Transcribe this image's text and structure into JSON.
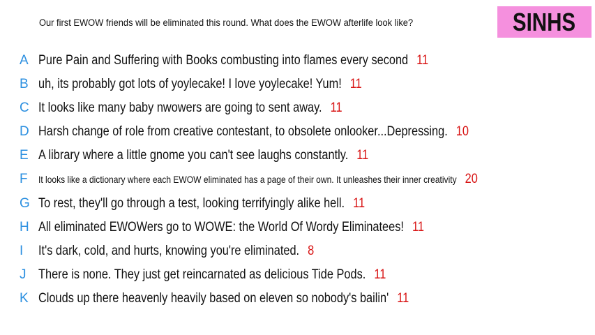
{
  "prompt": "Our first EWOW friends will be eliminated this round. What does the EWOW afterlife look like?",
  "badge": {
    "label": "SINHS",
    "color": "#f590de"
  },
  "colors": {
    "letter": "#2b8fe0",
    "score": "#d81414",
    "text": "#111111"
  },
  "entries": [
    {
      "letter": "A",
      "text": "Pure Pain and Suffering with Books combusting into flames every second",
      "score": "11"
    },
    {
      "letter": "B",
      "text": "uh, its probably got lots of yoylecake! I love yoylecake! Yum!",
      "score": "11"
    },
    {
      "letter": "C",
      "text": "It looks like many baby nwowers are going to sent away.",
      "score": "11"
    },
    {
      "letter": "D",
      "text": "Harsh change of role from creative contestant, to obsolete onlooker...Depressing.",
      "score": "10"
    },
    {
      "letter": "E",
      "text": "A library where a little gnome you can't see laughs constantly.",
      "score": "11"
    },
    {
      "letter": "F",
      "text": "It looks like a dictionary where each EWOW eliminated has a page of their own. It unleashes their inner creativity",
      "score": "20"
    },
    {
      "letter": "G",
      "text": "To rest, they'll go through a test, looking terrifyingly alike hell.",
      "score": "11"
    },
    {
      "letter": "H",
      "text": "All eliminated EWOWers go to WOWE: the World Of Wordy Eliminatees!",
      "score": "11"
    },
    {
      "letter": "I",
      "text": "It's dark, cold, and hurts, knowing you're eliminated.",
      "score": "8"
    },
    {
      "letter": "J",
      "text": "There is none. They just get reincarnated as delicious Tide Pods.",
      "score": "11"
    },
    {
      "letter": "K",
      "text": "Clouds up there heavenly heavily based on eleven so nobody's bailin'",
      "score": "11"
    }
  ]
}
